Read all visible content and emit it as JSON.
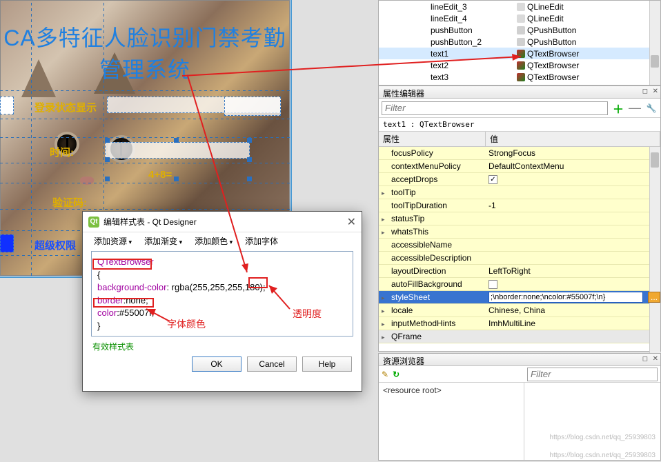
{
  "appTitle": "CA多特征人脸识别门禁考勤管理系统",
  "labels": {
    "loginStatus": "登录状态显示",
    "time": "时间:",
    "equation": "4+8=",
    "verify": "验证码:",
    "super": "超级权限"
  },
  "inspector": {
    "rows": [
      {
        "name": "lineEdit_3",
        "cls": "QLineEdit",
        "ico": "line"
      },
      {
        "name": "lineEdit_4",
        "cls": "QLineEdit",
        "ico": "line"
      },
      {
        "name": "pushButton",
        "cls": "QPushButton",
        "ico": "btn"
      },
      {
        "name": "pushButton_2",
        "cls": "QPushButton",
        "ico": "btn"
      },
      {
        "name": "text1",
        "cls": "QTextBrowser",
        "ico": "txt",
        "sel": true
      },
      {
        "name": "text2",
        "cls": "QTextBrowser",
        "ico": "txt"
      },
      {
        "name": "text3",
        "cls": "QTextBrowser",
        "ico": "txt"
      }
    ]
  },
  "props": {
    "title": "属性编辑器",
    "filter": "Filter",
    "obj": "text1 : QTextBrowser",
    "hdrProp": "属性",
    "hdrVal": "值",
    "rows": [
      {
        "name": "focusPolicy",
        "val": "StrongFocus"
      },
      {
        "name": "contextMenuPolicy",
        "val": "DefaultContextMenu"
      },
      {
        "name": "acceptDrops",
        "val": "",
        "chk": true,
        "chkon": true
      },
      {
        "name": "toolTip",
        "val": "",
        "exp": true
      },
      {
        "name": "toolTipDuration",
        "val": "-1"
      },
      {
        "name": "statusTip",
        "val": "",
        "exp": true
      },
      {
        "name": "whatsThis",
        "val": "",
        "exp": true
      },
      {
        "name": "accessibleName",
        "val": ""
      },
      {
        "name": "accessibleDescription",
        "val": ""
      },
      {
        "name": "layoutDirection",
        "val": "LeftToRight"
      },
      {
        "name": "autoFillBackground",
        "val": "",
        "chk": true,
        "chkon": false
      },
      {
        "name": "styleSheet",
        "val": ";\\nborder:none;\\ncolor:#55007f;\\n}",
        "sel": true,
        "exp": true
      },
      {
        "name": "locale",
        "val": "Chinese, China",
        "exp": true
      },
      {
        "name": "inputMethodHints",
        "val": "ImhMultiLine",
        "exp": true
      },
      {
        "name": "QFrame",
        "val": "",
        "grp": true,
        "exp": true
      }
    ]
  },
  "resBrowser": {
    "title": "资源浏览器",
    "filter": "Filter",
    "root": "<resource root>",
    "wm1": "https://blog.csdn.net/qq_25939803",
    "wm2": "https://blog.csdn.net/qq_25939803"
  },
  "dialog": {
    "title": "编辑样式表 - Qt Designer",
    "menu": [
      "添加资源",
      "添加渐变",
      "添加颜色",
      "添加字体"
    ],
    "code": {
      "l1": "QTextBrowser",
      "l2": "{",
      "l3a": "background-color",
      "l3b": ": rgba(255,255,255,180);",
      "l4a": "border",
      "l4b": ":none;",
      "l5a": "color",
      "l5b": ":#55007f;",
      "l6": "}"
    },
    "status": "有效样式表",
    "btns": {
      "ok": "OK",
      "cancel": "Cancel",
      "help": "Help"
    }
  },
  "anno": {
    "opacity": "透明度",
    "fontcolor": "字体颜色"
  }
}
